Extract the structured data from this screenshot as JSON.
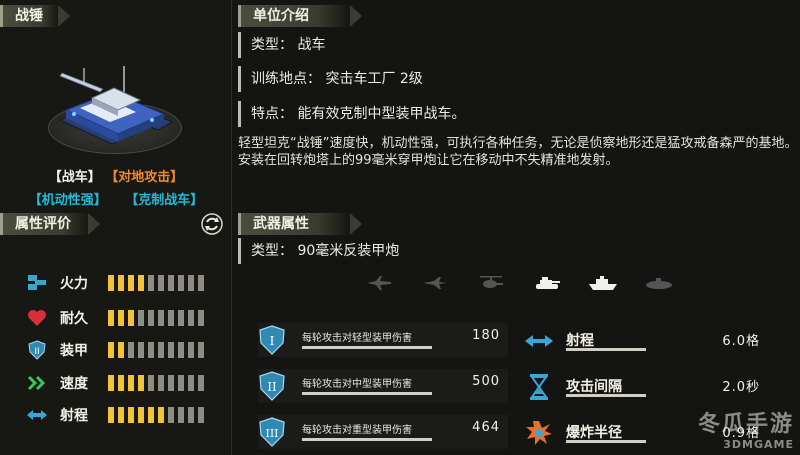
{
  "left": {
    "unit_header": "战锤",
    "tags_row1": [
      "【战车】",
      "【对地攻击】"
    ],
    "tags_row2": [
      "【机动性强】",
      "【克制战车】"
    ],
    "attr_header": "属性评价",
    "attributes": [
      {
        "label": "火力",
        "icon": "firepower-icon",
        "value": 4,
        "max": 10
      },
      {
        "label": "耐久",
        "icon": "heart-icon",
        "value": 3,
        "max": 10
      },
      {
        "label": "装甲",
        "icon": "armor-shield-icon",
        "value": 2,
        "max": 10
      },
      {
        "label": "速度",
        "icon": "speed-chevron-icon",
        "value": 4,
        "max": 10
      },
      {
        "label": "射程",
        "icon": "range-arrows-icon",
        "value": 6,
        "max": 10
      }
    ]
  },
  "right": {
    "intro_header": "单位介绍",
    "type_key": "类型：",
    "type_val": "战车",
    "train_key": "训练地点：",
    "train_val": "突击车工厂  2级",
    "feature_key": "特点：",
    "feature_val": "能有效克制中型装甲战车。",
    "description": "轻型坦克“战锤”速度快，机动性强，可执行各种任务，无论是侦察地形还是猛攻戒备森严的基地。安装在回转炮塔上的99毫米穿甲炮让它在移动中不失精准地发射。",
    "weapon_header": "武器属性",
    "weapon_type_key": "类型：",
    "weapon_type_val": "90毫米反装甲炮",
    "target_icons": [
      "jet-icon",
      "bomber-icon",
      "helicopter-icon",
      "tank-icon",
      "ship-icon",
      "submarine-icon"
    ],
    "damage_stats": [
      {
        "badge": "I",
        "label": "每轮攻击对轻型装甲伤害",
        "value": "180"
      },
      {
        "badge": "II",
        "label": "每轮攻击对中型装甲伤害",
        "value": "500"
      },
      {
        "badge": "III",
        "label": "每轮攻击对重型装甲伤害",
        "value": "464"
      }
    ],
    "other_stats": [
      {
        "icon": "range-arrows-icon",
        "label": "射程",
        "value": "6.0格"
      },
      {
        "icon": "hourglass-icon",
        "label": "攻击间隔",
        "value": "2.0秒"
      },
      {
        "icon": "explosion-icon",
        "label": "爆炸半径",
        "value": "0.9格"
      }
    ]
  },
  "watermark": {
    "line1": "冬瓜手游",
    "line2": "3DMGAME"
  },
  "colors": {
    "accent_yellow": "#f2c33a",
    "tag_orange": "#f08a2a",
    "tag_cyan": "#27b8d4"
  }
}
